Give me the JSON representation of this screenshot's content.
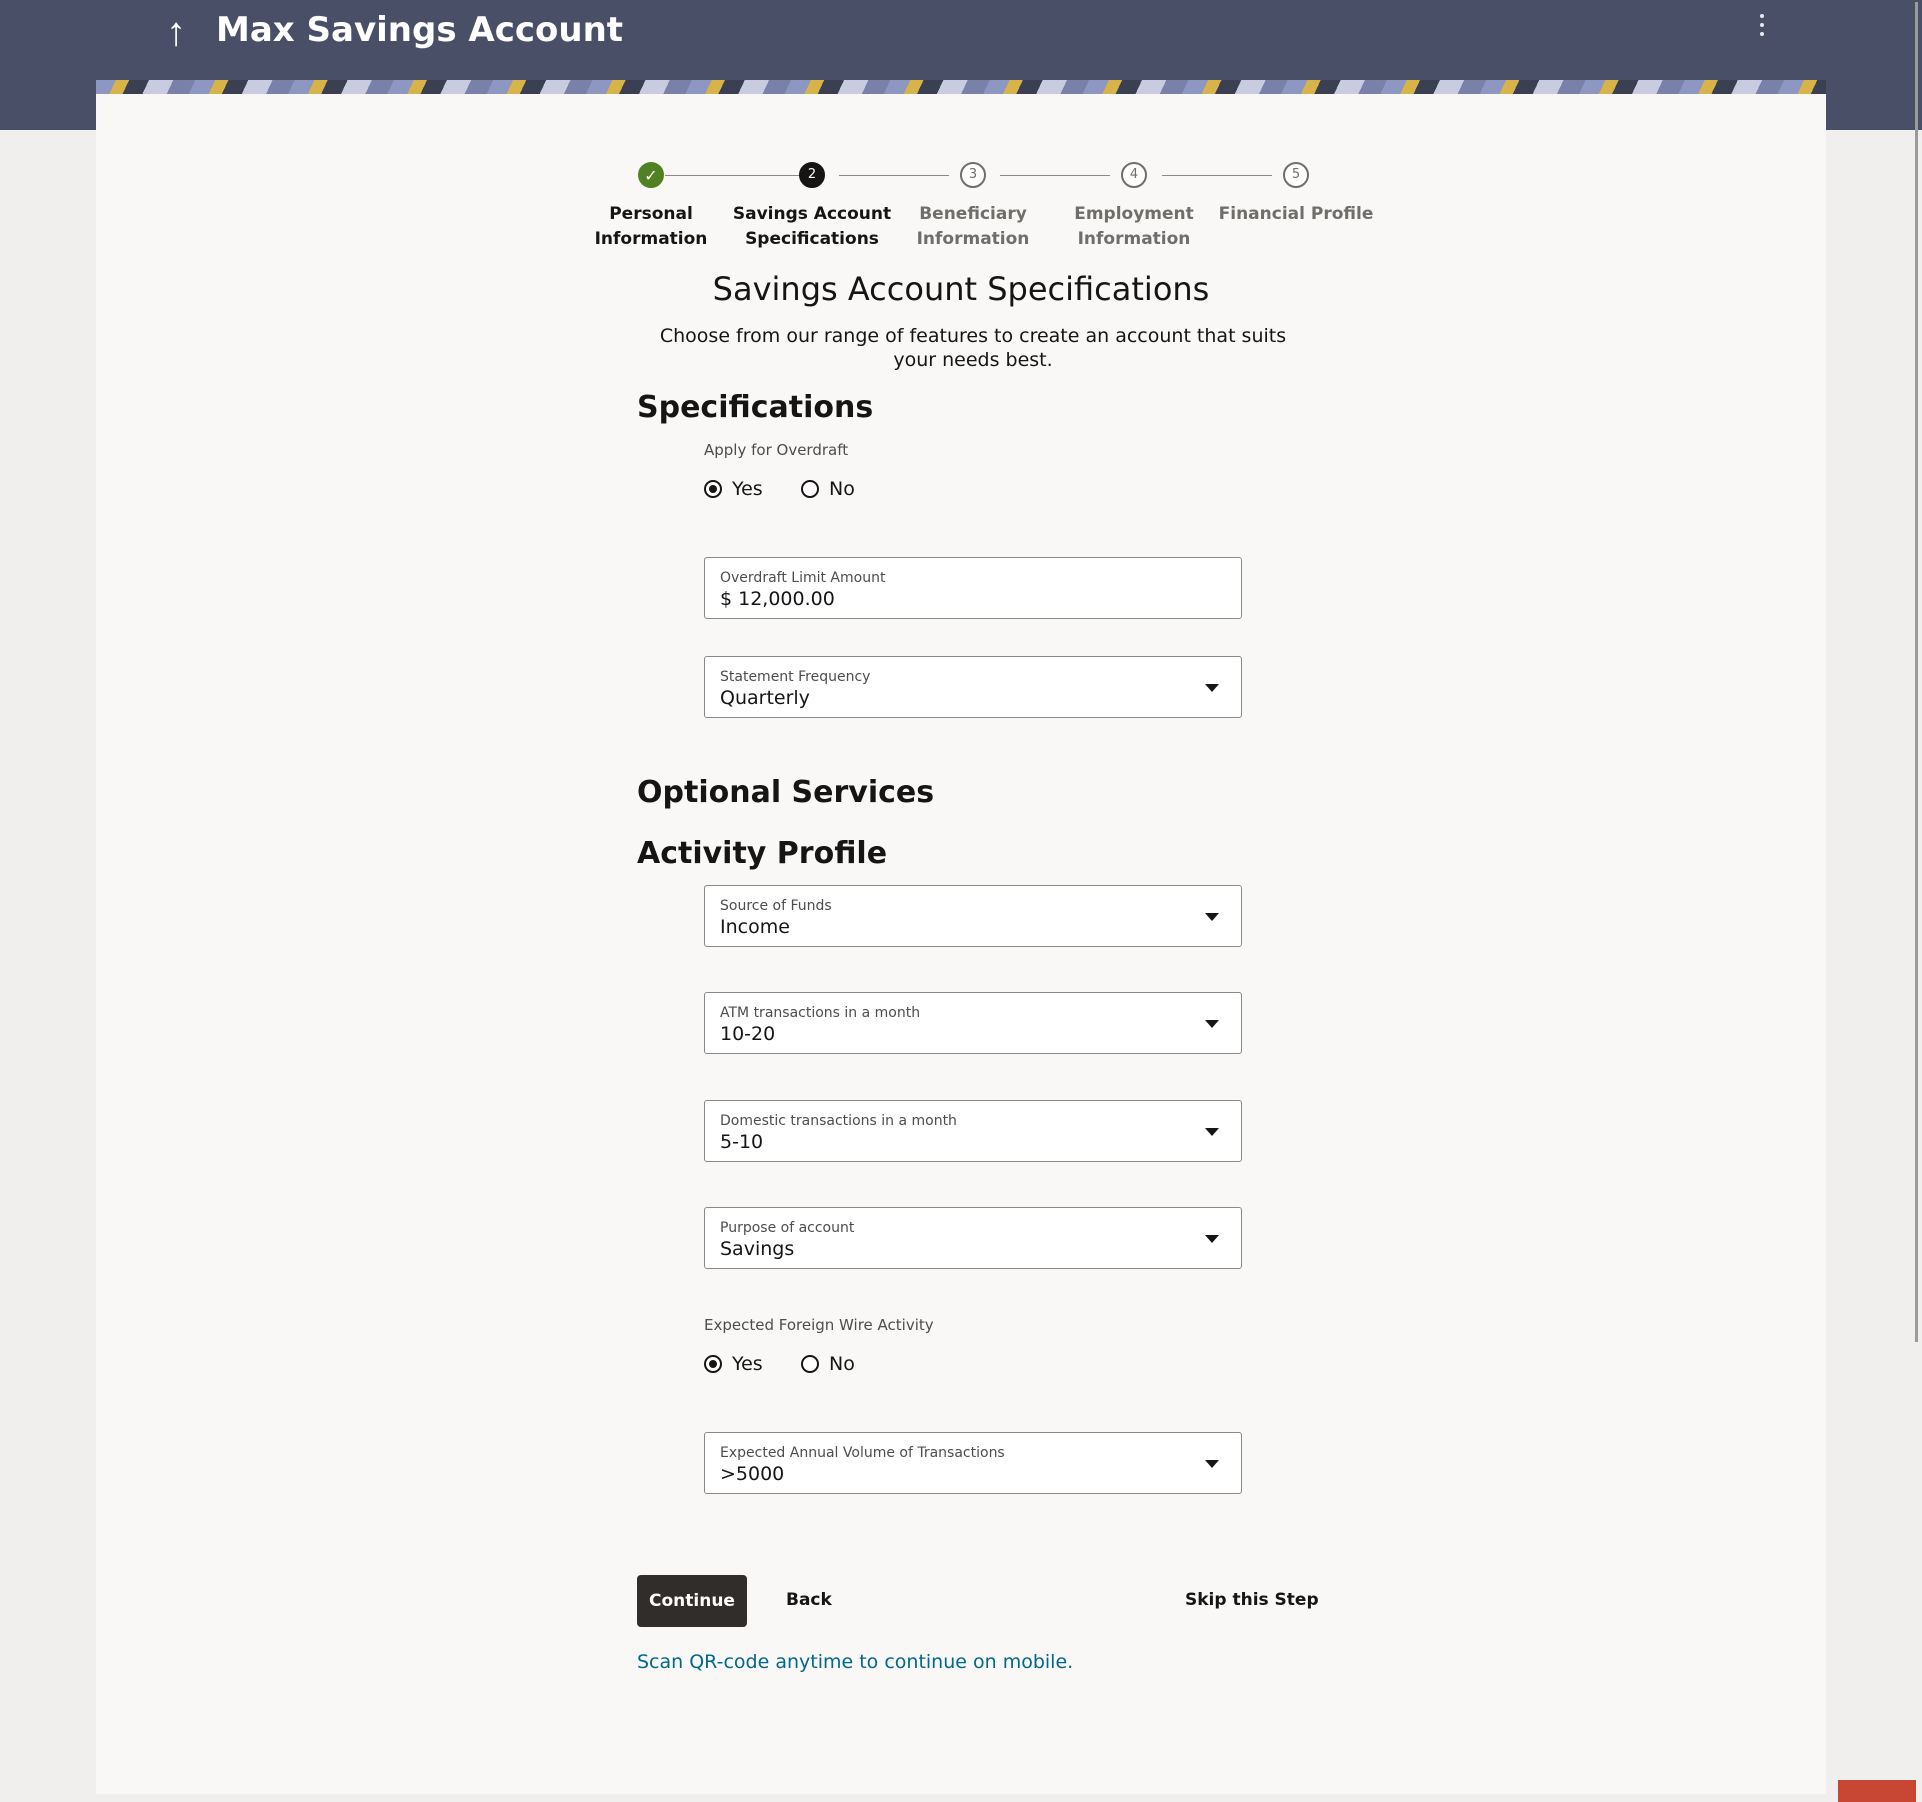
{
  "header": {
    "title": "Max Savings Account",
    "back_icon": "↑"
  },
  "stepper": {
    "steps": [
      {
        "number": "✓",
        "line1": "Personal",
        "line2": "Information",
        "state": "done"
      },
      {
        "number": "2",
        "line1": "Savings Account",
        "line2": "Specifications",
        "state": "active"
      },
      {
        "number": "3",
        "line1": "Beneficiary",
        "line2": "Information",
        "state": "pending"
      },
      {
        "number": "4",
        "line1": "Employment",
        "line2": "Information",
        "state": "pending"
      },
      {
        "number": "5",
        "line1": "Financial Profile",
        "line2": "",
        "state": "pending"
      }
    ]
  },
  "page": {
    "title": "Savings Account Specifications",
    "subtitle": "Choose from our range of features to create an account that suits your needs best."
  },
  "specifications": {
    "heading": "Specifications",
    "overdraft": {
      "label": "Apply for Overdraft",
      "yes": "Yes",
      "no": "No",
      "selected": "Yes"
    },
    "overdraft_limit": {
      "label": "Overdraft Limit Amount",
      "value": "$ 12,000.00"
    },
    "statement_frequency": {
      "label": "Statement Frequency",
      "value": "Quarterly"
    }
  },
  "optional_services": {
    "heading": "Optional Services"
  },
  "activity_profile": {
    "heading": "Activity Profile",
    "source_of_funds": {
      "label": "Source of Funds",
      "value": "Income"
    },
    "atm_transactions": {
      "label": "ATM transactions in a month",
      "value": "10-20"
    },
    "domestic_transactions": {
      "label": "Domestic transactions in a month",
      "value": "5-10"
    },
    "purpose": {
      "label": "Purpose of account",
      "value": "Savings"
    },
    "foreign_wire": {
      "label": "Expected Foreign Wire Activity",
      "yes": "Yes",
      "no": "No",
      "selected": "Yes"
    },
    "annual_volume": {
      "label": "Expected Annual Volume of Transactions",
      "value": ">5000"
    }
  },
  "actions": {
    "continue": "Continue",
    "back": "Back",
    "skip": "Skip this Step",
    "qr": "Scan QR-code anytime to continue on mobile."
  },
  "colors": {
    "header_bg": "#4a4f68",
    "done_step": "#508223",
    "primary_button": "#312d2a",
    "link": "#00688c"
  }
}
